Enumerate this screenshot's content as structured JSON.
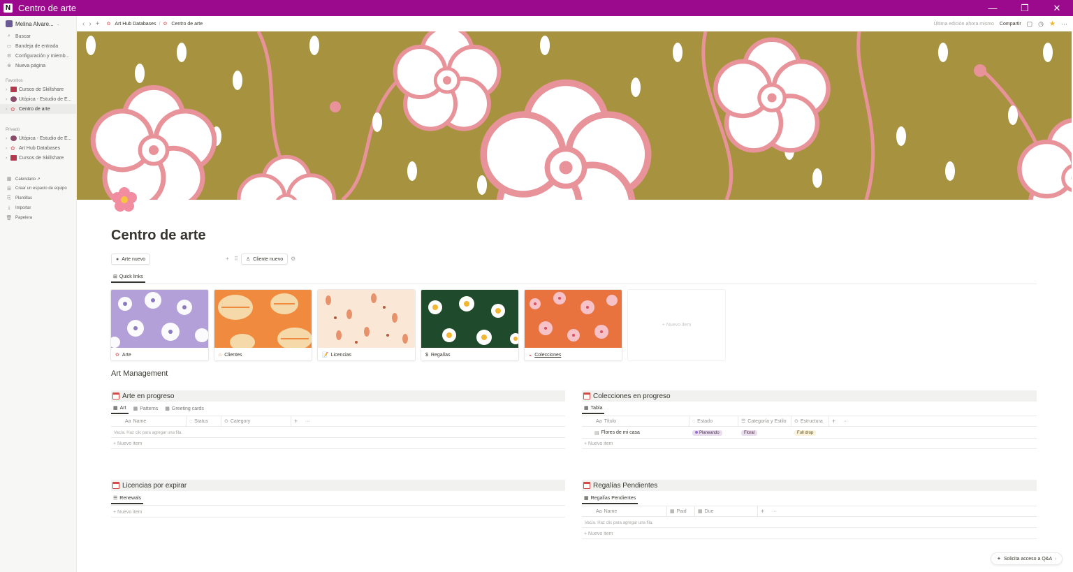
{
  "window": {
    "title": "Centro de arte",
    "minimize": "—",
    "restore": "❐",
    "close": "✕"
  },
  "sidebar": {
    "workspace": "Melina Alvare...",
    "top_items": [
      {
        "icon": "search-icon",
        "label": "Buscar"
      },
      {
        "icon": "inbox-icon",
        "label": "Bandeja de entrada"
      },
      {
        "icon": "gear-icon",
        "label": "Configuración y miemb..."
      },
      {
        "icon": "plus-circle-icon",
        "label": "Nueva página"
      }
    ],
    "favorites_label": "Favoritos",
    "favorites": [
      {
        "label": "Cursos de Skillshare",
        "color": "#b5394d"
      },
      {
        "label": "Utópica - Estudio de E...",
        "color": "#8a4a6a"
      },
      {
        "label": "Centro de arte",
        "color": "#e07c7c"
      }
    ],
    "private_label": "Privado",
    "private": [
      {
        "label": "Utópica - Estudio de E...",
        "color": "#8a4a6a"
      },
      {
        "label": "Art Hub Databases",
        "color": "#e07c7c"
      },
      {
        "label": "Cursos de Skillshare",
        "color": "#b5394d"
      }
    ],
    "bottom_items": [
      {
        "label": "Calendario ↗"
      },
      {
        "label": "Crear un espacio de equipo"
      },
      {
        "label": "Plantillas"
      },
      {
        "label": "Importar"
      },
      {
        "label": "Papelera"
      }
    ]
  },
  "topbar": {
    "breadcrumb": [
      "Art Hub Databases",
      "Centro de arte"
    ],
    "edited": "Última edición ahora mismo",
    "share": "Compartir"
  },
  "page": {
    "title": "Centro de arte",
    "buttons": {
      "new_art": "Arte nuevo",
      "new_client": "Cliente nuevo"
    },
    "quick_links_tab": "Quick links",
    "gallery": [
      {
        "label": "Arte",
        "icon": "palette-icon"
      },
      {
        "label": "Clientes",
        "icon": "home-icon"
      },
      {
        "label": "Licencias",
        "icon": "document-icon"
      },
      {
        "label": "Regalías",
        "icon": "dollar-icon"
      },
      {
        "label": "Colecciones",
        "icon": "collection-icon"
      }
    ],
    "gallery_new": "+ Nuevo item",
    "section_heading": "Art Management"
  },
  "db_art": {
    "title": "Arte en progreso",
    "tabs": [
      "Art",
      "Patterns",
      "Greeting cards"
    ],
    "columns": [
      "Name",
      "Status",
      "Category"
    ],
    "empty": "Vacía. Haz clic para agregar una fila.",
    "new": "+ Nuevo item"
  },
  "db_collections": {
    "title": "Colecciones en progreso",
    "tabs": [
      "Tabla"
    ],
    "columns": [
      "Título",
      "Estado",
      "Categoría y Estilo",
      "Estructura"
    ],
    "row": {
      "title": "Flores de mi casa",
      "estado": "Planeando",
      "categoria": "Floral",
      "estructura": "Full drop"
    },
    "new": "+ Nuevo item"
  },
  "db_licenses": {
    "title": "Licencias por expirar",
    "tabs": [
      "Renewals"
    ],
    "new": "+ Nuevo item"
  },
  "db_royalties": {
    "title": "Regalías Pendientes",
    "tabs": [
      "Regalías Pendientes"
    ],
    "columns": [
      "Name",
      "Paid",
      "Due"
    ],
    "empty": "Vacía. Haz clic para agregar una fila.",
    "new": "+ Nuevo item"
  },
  "qa_button": "Solicita acceso a Q&A",
  "colors": {
    "titlebar": "#9b0a8c",
    "cover": "#a7933f",
    "flower_pink": "#e8929a"
  }
}
